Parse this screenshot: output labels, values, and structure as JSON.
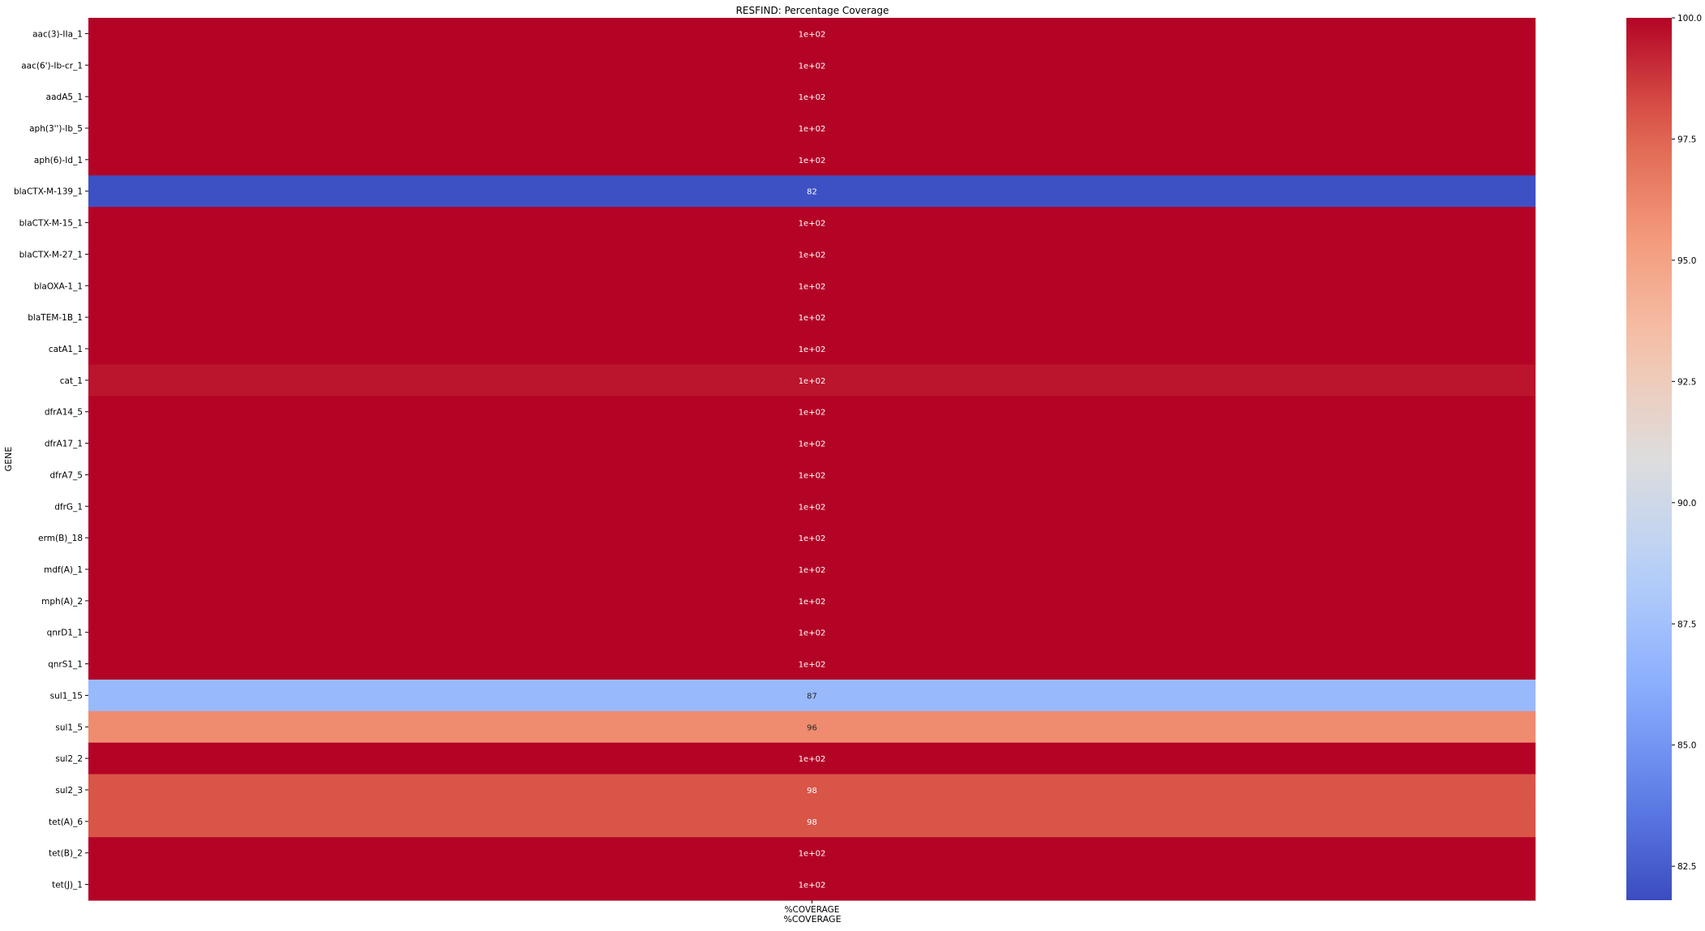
{
  "chart_data": {
    "type": "heatmap",
    "title": "RESFIND: Percentage Coverage",
    "ylabel": "GENE",
    "x_tick_labels": [
      "%COVERAGE"
    ],
    "xlabel": "%COVERAGE",
    "rows": [
      {
        "gene": "aac(3)-IIa_1",
        "value": 100,
        "label": "1e+02"
      },
      {
        "gene": "aac(6')-Ib-cr_1",
        "value": 100,
        "label": "1e+02"
      },
      {
        "gene": "aadA5_1",
        "value": 100,
        "label": "1e+02"
      },
      {
        "gene": "aph(3'')-Ib_5",
        "value": 100,
        "label": "1e+02"
      },
      {
        "gene": "aph(6)-Id_1",
        "value": 100,
        "label": "1e+02"
      },
      {
        "gene": "blaCTX-M-139_1",
        "value": 82,
        "label": "82"
      },
      {
        "gene": "blaCTX-M-15_1",
        "value": 100,
        "label": "1e+02"
      },
      {
        "gene": "blaCTX-M-27_1",
        "value": 100,
        "label": "1e+02"
      },
      {
        "gene": "blaOXA-1_1",
        "value": 100,
        "label": "1e+02"
      },
      {
        "gene": "blaTEM-1B_1",
        "value": 100,
        "label": "1e+02"
      },
      {
        "gene": "catA1_1",
        "value": 100,
        "label": "1e+02"
      },
      {
        "gene": "cat_1",
        "value": 99.6,
        "label": "1e+02"
      },
      {
        "gene": "dfrA14_5",
        "value": 100,
        "label": "1e+02"
      },
      {
        "gene": "dfrA17_1",
        "value": 100,
        "label": "1e+02"
      },
      {
        "gene": "dfrA7_5",
        "value": 100,
        "label": "1e+02"
      },
      {
        "gene": "dfrG_1",
        "value": 100,
        "label": "1e+02"
      },
      {
        "gene": "erm(B)_18",
        "value": 100,
        "label": "1e+02"
      },
      {
        "gene": "mdf(A)_1",
        "value": 100,
        "label": "1e+02"
      },
      {
        "gene": "mph(A)_2",
        "value": 100,
        "label": "1e+02"
      },
      {
        "gene": "qnrD1_1",
        "value": 100,
        "label": "1e+02"
      },
      {
        "gene": "qnrS1_1",
        "value": 100,
        "label": "1e+02"
      },
      {
        "gene": "sul1_15",
        "value": 87,
        "label": "87"
      },
      {
        "gene": "sul1_5",
        "value": 96,
        "label": "96"
      },
      {
        "gene": "sul2_2",
        "value": 100,
        "label": "1e+02"
      },
      {
        "gene": "sul2_3",
        "value": 98,
        "label": "98"
      },
      {
        "gene": "tet(A)_6",
        "value": 98,
        "label": "98"
      },
      {
        "gene": "tet(B)_2",
        "value": 100,
        "label": "1e+02"
      },
      {
        "gene": "tet(J)_1",
        "value": 100,
        "label": "1e+02"
      }
    ],
    "colorbar": {
      "colormap": "coolwarm",
      "vmin": 81.8,
      "vmax": 100,
      "ticks": [
        82.5,
        85.0,
        87.5,
        90.0,
        92.5,
        95.0,
        97.5,
        100.0
      ],
      "tick_labels": [
        "82.5",
        "85.0",
        "87.5",
        "90.0",
        "92.5",
        "95.0",
        "97.5",
        "100.0"
      ]
    }
  }
}
